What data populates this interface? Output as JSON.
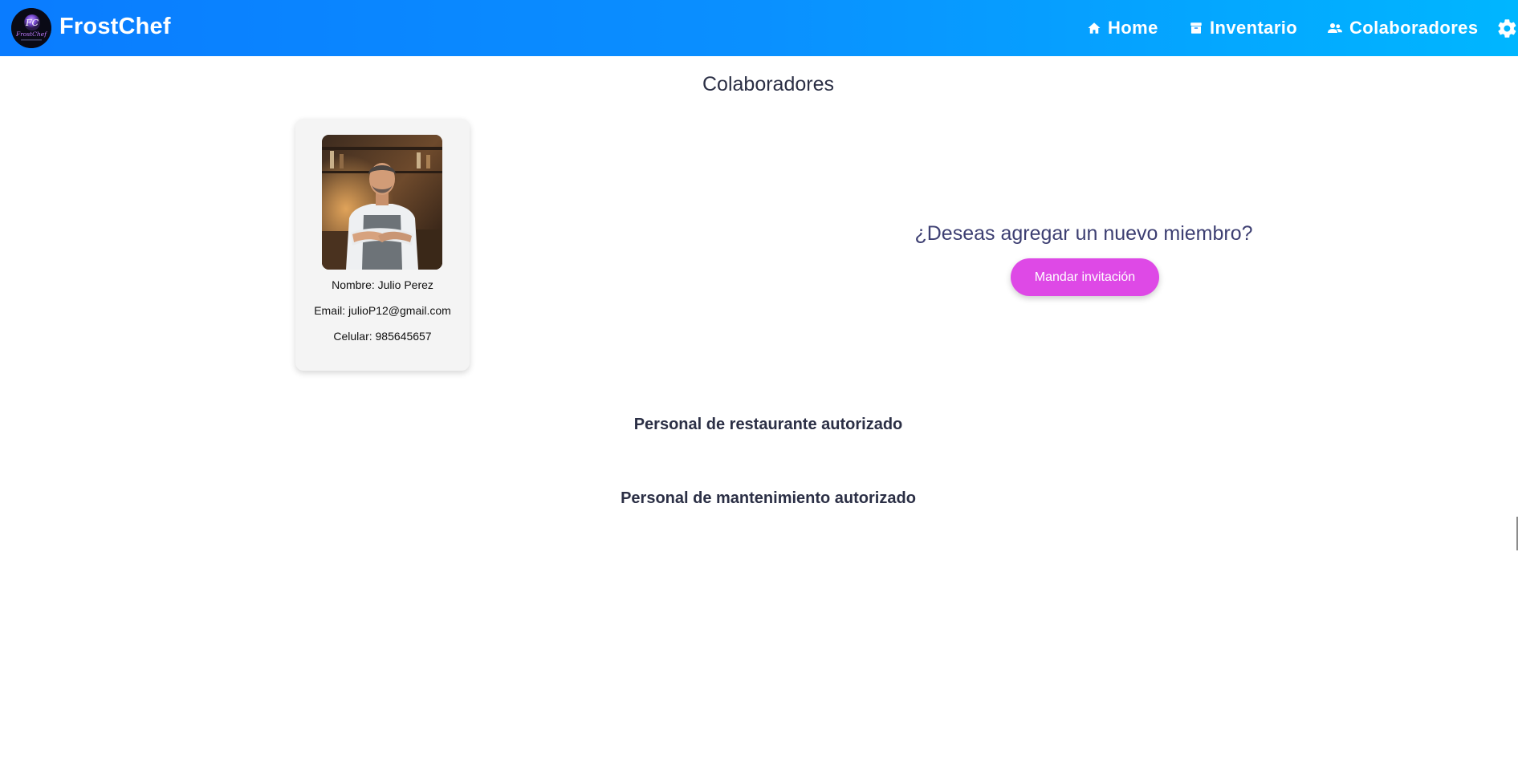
{
  "app": {
    "name": "FrostChef",
    "logo_text": "FrostChef"
  },
  "nav": {
    "items": [
      {
        "label": "Home",
        "icon": "home-icon"
      },
      {
        "label": "Inventario",
        "icon": "archive-icon"
      },
      {
        "label": "Colaboradores",
        "icon": "people-icon"
      }
    ],
    "settings_icon": "gear-icon"
  },
  "page": {
    "title": "Colaboradores"
  },
  "collaborators": [
    {
      "name": "Nombre: Julio Perez",
      "email": "Email: julioP12@gmail.com",
      "phone": "Celular: 985645657"
    }
  ],
  "invite": {
    "question": "¿Deseas agregar un nuevo miembro?",
    "button_label": "Mandar invitación"
  },
  "sections": {
    "restaurant": "Personal de restaurante autorizado",
    "maintenance": "Personal de mantenimiento autorizado"
  },
  "colors": {
    "nav_gradient_start": "#0a7cff",
    "nav_gradient_end": "#00b6ff",
    "invite_button": "#de49e6"
  }
}
